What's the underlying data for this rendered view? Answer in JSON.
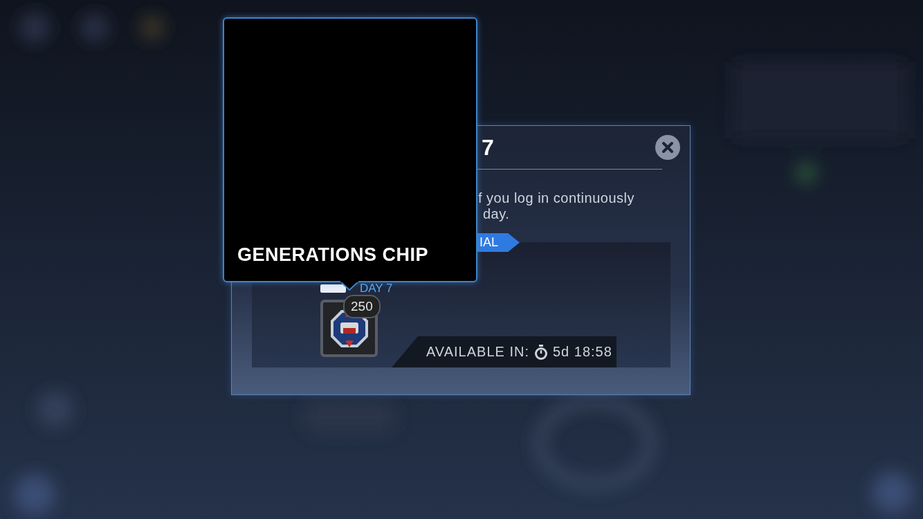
{
  "dialog": {
    "title": "7",
    "description_lines": [
      "f you log in continuously",
      "day."
    ],
    "ribbon": "IAL",
    "reward": {
      "day_label": "DAY 7",
      "quantity": "250",
      "availability_label": "AVAILABLE IN:",
      "availability_time": "5d 18:58"
    }
  },
  "tooltip": {
    "title": "GENERATIONS CHIP"
  }
}
